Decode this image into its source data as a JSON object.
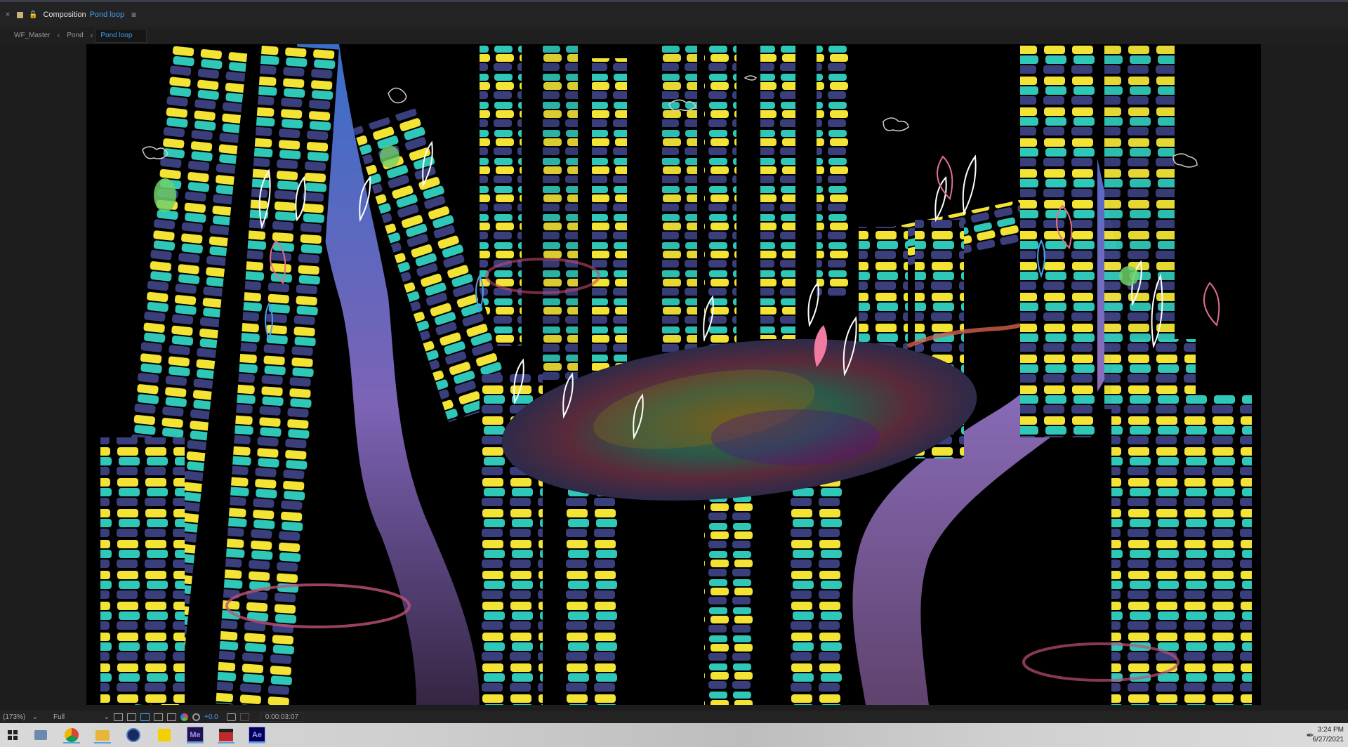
{
  "panel": {
    "close_glyph": "×",
    "panel_title": "Composition",
    "comp_name": "Pond loop",
    "menu_glyph": "≡"
  },
  "breadcrumb": {
    "items": [
      "WF_Master",
      "Pond",
      "Pond loop"
    ],
    "separator": "‹"
  },
  "viewer_footer": {
    "zoom": "(173%)",
    "resolution": "Full",
    "exposure": "+0.0",
    "timecode": "0:00:03:07"
  },
  "taskbar": {
    "apps": [
      {
        "name": "start",
        "label": ""
      },
      {
        "name": "file-manager",
        "label": ""
      },
      {
        "name": "chrome",
        "label": ""
      },
      {
        "name": "folder",
        "label": ""
      },
      {
        "name": "cinema4d",
        "label": ""
      },
      {
        "name": "sticky-notes",
        "label": ""
      },
      {
        "name": "media-encoder",
        "label": "Me"
      },
      {
        "name": "slate",
        "label": ""
      },
      {
        "name": "after-effects",
        "label": "Ae"
      }
    ],
    "time": "3:24 PM",
    "date": "6/27/2021"
  },
  "colors": {
    "accent_blue": "#3e9cf0",
    "me_bg": "#1f1245",
    "me_fg": "#9b8cff",
    "ae_bg": "#00005b",
    "ae_fg": "#9999ff",
    "scene_yellow": "#f2e335",
    "scene_teal": "#2fc7b7",
    "scene_indigo": "#3a3f7c"
  }
}
